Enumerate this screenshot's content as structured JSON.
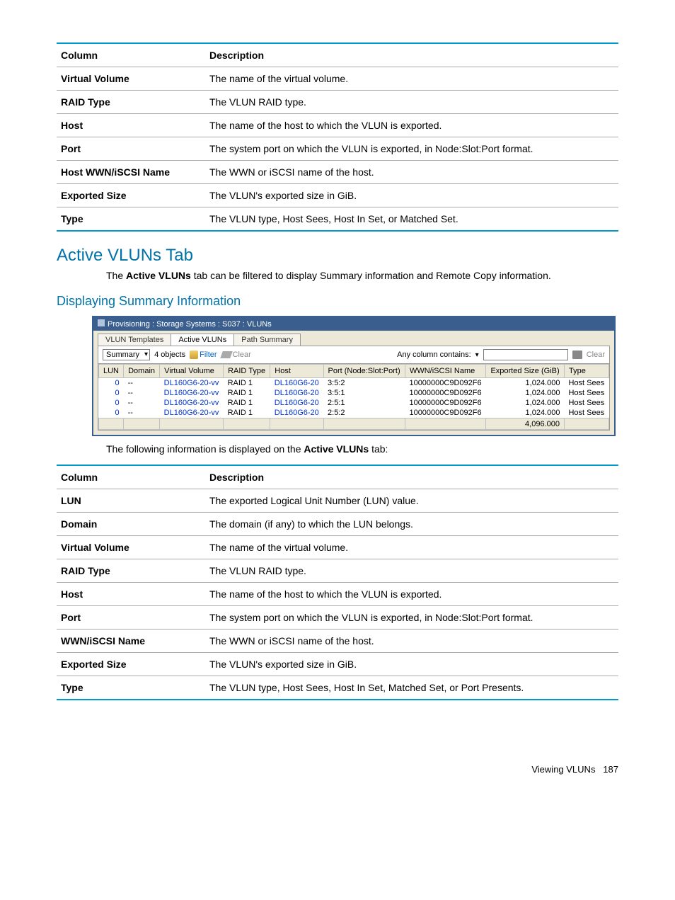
{
  "table1": {
    "headers": [
      "Column",
      "Description"
    ],
    "rows": [
      [
        "Virtual Volume",
        "The name of the virtual volume."
      ],
      [
        "RAID Type",
        "The VLUN RAID type."
      ],
      [
        "Host",
        "The name of the host to which the VLUN is exported."
      ],
      [
        "Port",
        "The system port on which the VLUN is exported, in Node:Slot:Port format."
      ],
      [
        "Host WWN/iSCSI Name",
        "The WWN or iSCSI name of the host."
      ],
      [
        "Exported Size",
        "The VLUN's exported size in GiB."
      ],
      [
        "Type",
        "The VLUN type, Host Sees, Host In Set, or Matched Set."
      ]
    ]
  },
  "sections": {
    "active_vluns_tab": "Active VLUNs Tab",
    "active_vluns_intro_pre": "The ",
    "active_vluns_intro_bold": "Active VLUNs",
    "active_vluns_intro_post": " tab can be filtered to display Summary information and Remote Copy information.",
    "displaying_summary": "Displaying Summary Information",
    "following_info_pre": "The following information is displayed on the ",
    "following_info_bold": "Active VLUNs",
    "following_info_post": " tab:"
  },
  "screenshot": {
    "title": "Provisioning : Storage Systems : S037 : VLUNs",
    "tabs": [
      "VLUN Templates",
      "Active VLUNs",
      "Path Summary"
    ],
    "active_tab_index": 1,
    "toolbar": {
      "dropdown": "Summary",
      "objects": "4 objects",
      "filter": "Filter",
      "clear_filter": "Clear",
      "any_col": "Any column contains:",
      "clear_search": "Clear"
    },
    "grid": {
      "headers": [
        "LUN",
        "Domain",
        "Virtual Volume",
        "RAID Type",
        "Host",
        "Port (Node:Slot:Port)",
        "WWN/iSCSI Name",
        "Exported Size (GiB)",
        "Type"
      ],
      "rows": [
        {
          "lun": "0",
          "domain": "--",
          "vv": "DL160G6-20-vv",
          "raid": "RAID 1",
          "host": "DL160G6-20",
          "port": "3:5:2",
          "wwn": "10000000C9D092F6",
          "size": "1,024.000",
          "type": "Host Sees"
        },
        {
          "lun": "0",
          "domain": "--",
          "vv": "DL160G6-20-vv",
          "raid": "RAID 1",
          "host": "DL160G6-20",
          "port": "3:5:1",
          "wwn": "10000000C9D092F6",
          "size": "1,024.000",
          "type": "Host Sees"
        },
        {
          "lun": "0",
          "domain": "--",
          "vv": "DL160G6-20-vv",
          "raid": "RAID 1",
          "host": "DL160G6-20",
          "port": "2:5:1",
          "wwn": "10000000C9D092F6",
          "size": "1,024.000",
          "type": "Host Sees"
        },
        {
          "lun": "0",
          "domain": "--",
          "vv": "DL160G6-20-vv",
          "raid": "RAID 1",
          "host": "DL160G6-20",
          "port": "2:5:2",
          "wwn": "10000000C9D092F6",
          "size": "1,024.000",
          "type": "Host Sees"
        }
      ],
      "footer_total": "4,096.000"
    }
  },
  "table2": {
    "headers": [
      "Column",
      "Description"
    ],
    "rows": [
      [
        "LUN",
        "The exported Logical Unit Number (LUN) value."
      ],
      [
        "Domain",
        "The domain (if any) to which the LUN belongs."
      ],
      [
        "Virtual Volume",
        "The name of the virtual volume."
      ],
      [
        "RAID Type",
        "The VLUN RAID type."
      ],
      [
        "Host",
        "The name of the host to which the VLUN is exported."
      ],
      [
        "Port",
        "The system port on which the VLUN is exported, in Node:Slot:Port format."
      ],
      [
        "WWN/iSCSI Name",
        "The WWN or iSCSI name of the host."
      ],
      [
        "Exported Size",
        "The VLUN's exported size in GiB."
      ],
      [
        "Type",
        "The VLUN type, Host Sees, Host In Set, Matched Set, or Port Presents."
      ]
    ]
  },
  "footer": {
    "label": "Viewing VLUNs",
    "page": "187"
  }
}
